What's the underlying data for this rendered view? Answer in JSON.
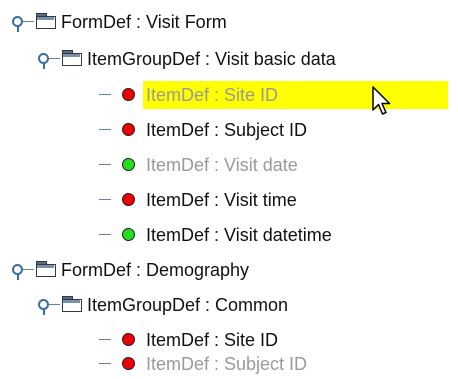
{
  "tree": {
    "nodes": [
      {
        "label": "FormDef : Visit Form",
        "kind": "form",
        "expanded": true
      },
      {
        "label": "ItemGroupDef : Visit basic data",
        "kind": "group",
        "expanded": true
      },
      {
        "label": "ItemDef : Site ID",
        "kind": "item",
        "status": "red",
        "selected": true
      },
      {
        "label": "ItemDef : Subject ID",
        "kind": "item",
        "status": "red"
      },
      {
        "label": "ItemDef : Visit date",
        "kind": "item",
        "status": "green",
        "dimmed": true
      },
      {
        "label": "ItemDef : Visit time",
        "kind": "item",
        "status": "red"
      },
      {
        "label": "ItemDef : Visit datetime",
        "kind": "item",
        "status": "green"
      },
      {
        "label": "FormDef : Demography",
        "kind": "form",
        "expanded": true
      },
      {
        "label": "ItemGroupDef : Common",
        "kind": "group",
        "expanded": true
      },
      {
        "label": "ItemDef : Site ID",
        "kind": "item",
        "status": "red"
      },
      {
        "label": "ItemDef : Subject ID",
        "kind": "item",
        "status": "red",
        "dimmed": true
      }
    ]
  },
  "colors": {
    "selection_highlight": "#ffff00",
    "status_red": "#ee0000",
    "status_green": "#22dd22",
    "handle_blue": "#3a6ea5"
  },
  "icons": {
    "expand_handle": "tree-expanded-handle-icon",
    "folder": "folder-icon",
    "status_dot": "status-dot-icon",
    "cursor": "mouse-pointer-icon"
  }
}
